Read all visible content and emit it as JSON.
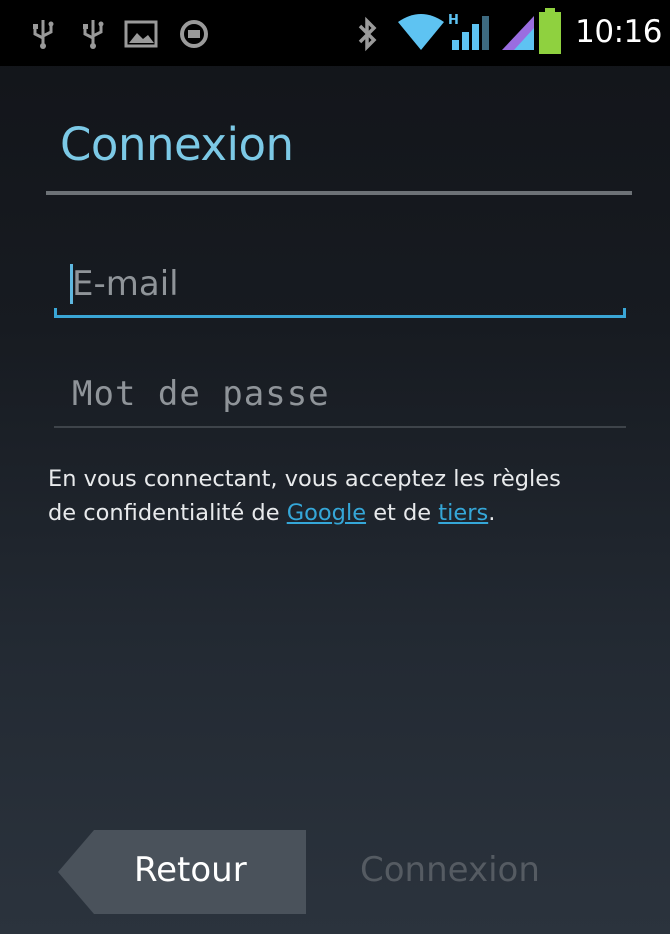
{
  "status_bar": {
    "time": "10:16",
    "icons": [
      "usb-icon",
      "usb-icon",
      "image-notification-icon",
      "sync-icon",
      "bluetooth-icon",
      "wifi-icon",
      "signal-h-icon",
      "signal-icon",
      "battery-icon"
    ],
    "accent": "#5ec3f2"
  },
  "header": {
    "title": "Connexion"
  },
  "form": {
    "email_placeholder": "E-mail",
    "email_value": "",
    "password_placeholder": "Mot de passe",
    "password_value": ""
  },
  "disclaimer": {
    "text_before": " En vous connectant, vous acceptez les règles de confidentialité de ",
    "google_link": "Google",
    "text_middle": " et de ",
    "third_party_link": "tiers",
    "text_end": "."
  },
  "footer": {
    "back_label": "Retour",
    "connect_label": "Connexion"
  },
  "colors": {
    "title": "#7cc9e6",
    "link": "#35a7d8",
    "focus_underline": "#3aa6d6",
    "disabled_text": "#555b62"
  }
}
